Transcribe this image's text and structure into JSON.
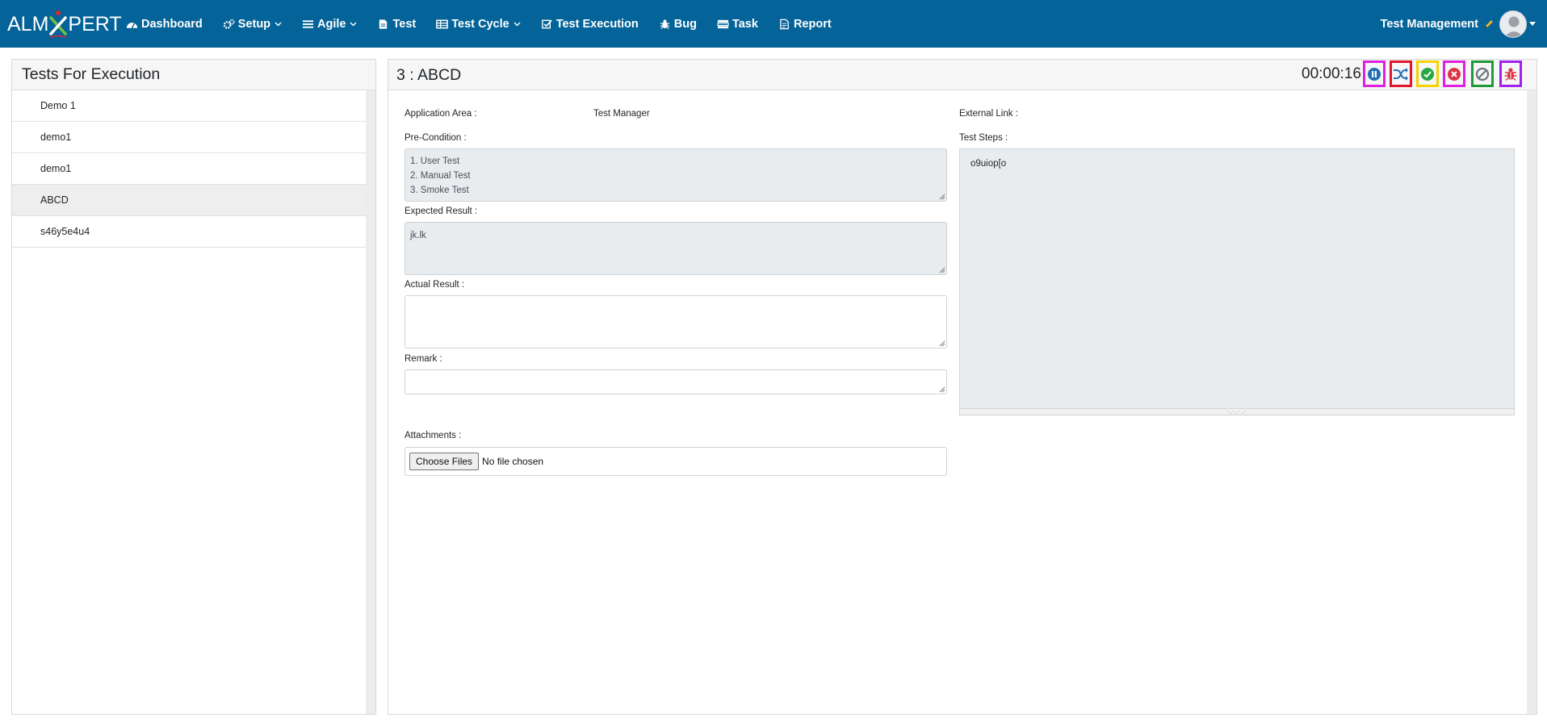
{
  "brand": {
    "text_left": "ALM",
    "text_right": "PERT"
  },
  "nav": {
    "items": [
      {
        "label": "Dashboard",
        "icon": "dashboard-icon",
        "dropdown": false
      },
      {
        "label": "Setup",
        "icon": "cogs-icon",
        "dropdown": true
      },
      {
        "label": "Agile",
        "icon": "list-icon",
        "dropdown": true
      },
      {
        "label": "Test",
        "icon": "file-icon",
        "dropdown": false
      },
      {
        "label": "Test Cycle",
        "icon": "table-icon",
        "dropdown": true
      },
      {
        "label": "Test Execution",
        "icon": "check-square-icon",
        "dropdown": false
      },
      {
        "label": "Bug",
        "icon": "bug-icon",
        "dropdown": false
      },
      {
        "label": "Task",
        "icon": "tasks-icon",
        "dropdown": false
      },
      {
        "label": "Report",
        "icon": "report-icon",
        "dropdown": false
      }
    ],
    "project": "Test Management"
  },
  "left_panel": {
    "title": "Tests For Execution",
    "items": [
      {
        "label": "Demo 1",
        "active": false
      },
      {
        "label": "demo1",
        "active": false
      },
      {
        "label": "demo1",
        "active": false
      },
      {
        "label": "ABCD",
        "active": true
      },
      {
        "label": "s46y5e4u4",
        "active": false
      }
    ]
  },
  "detail": {
    "title": "3 : ABCD",
    "timer": "00:00:16",
    "actions": [
      {
        "name": "pause-button",
        "icon": "pause-icon",
        "border": "#e020e0",
        "color": "#1f6fb5"
      },
      {
        "name": "shuffle-button",
        "icon": "shuffle-icon",
        "border": "#e0182c",
        "color": "#1f6fb5"
      },
      {
        "name": "pass-button",
        "icon": "check-circle-icon",
        "border": "#f5d300",
        "color": "#28a745"
      },
      {
        "name": "fail-button",
        "icon": "x-circle-icon",
        "border": "#e020e0",
        "color": "#dc3545"
      },
      {
        "name": "blocked-button",
        "icon": "ban-icon",
        "border": "#1e9a3c",
        "color": "#6c757d"
      },
      {
        "name": "log-bug-button",
        "icon": "bug-icon",
        "border": "#a020f0",
        "color": "#dc3545"
      }
    ],
    "application_area_label": "Application Area :",
    "application_area_value": "Test Manager",
    "external_link_label": "External Link :",
    "precondition_label": "Pre-Condition :",
    "precondition_lines": [
      "1. User Test",
      "2. Manual Test",
      "3. Smoke Test"
    ],
    "expected_label": "Expected Result :",
    "expected_value": "jk.lk",
    "actual_label": "Actual Result :",
    "actual_value": "",
    "remark_label": "Remark :",
    "remark_value": "",
    "steps_label": "Test Steps :",
    "steps_value": "o9uiop[o",
    "attachments_label": "Attachments :",
    "file_button": "Choose Files",
    "file_text": "No file chosen"
  }
}
